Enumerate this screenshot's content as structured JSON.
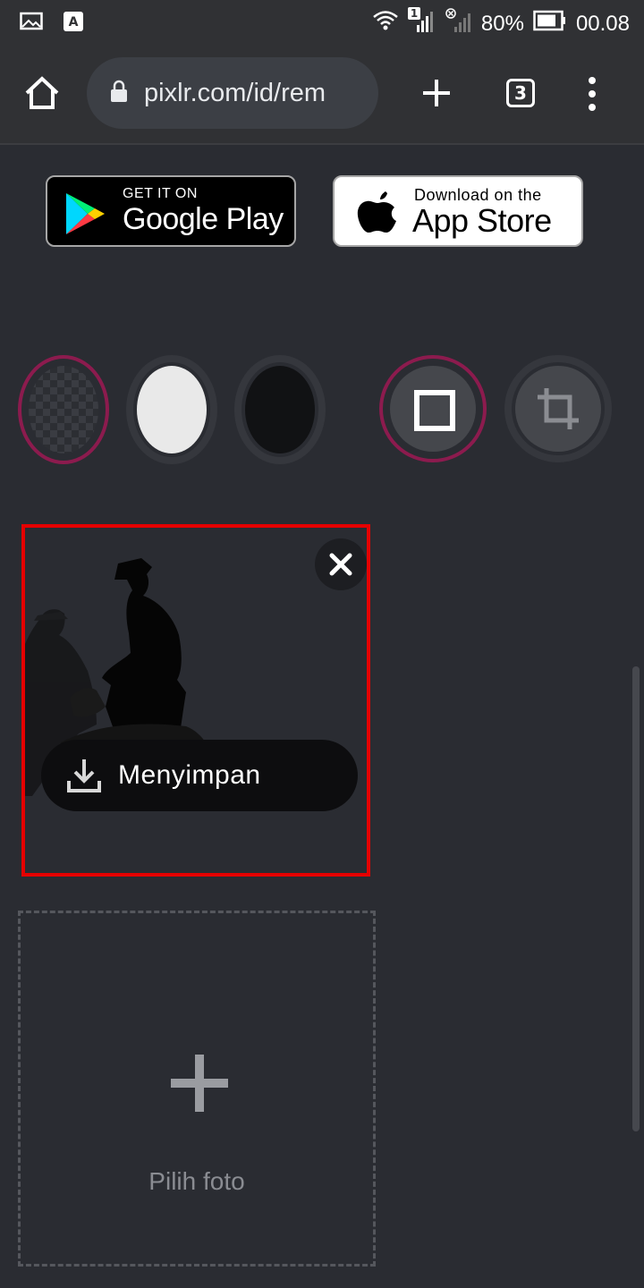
{
  "status_bar": {
    "notification_icons": [
      "gallery-icon",
      "a-letter-icon"
    ],
    "sim_badge": "1",
    "battery": "80%",
    "time": "00.08"
  },
  "browser": {
    "url": "pixlr.com/id/rem",
    "tab_count": "3"
  },
  "store_badges": {
    "google_play": {
      "small": "GET IT ON",
      "big": "Google Play"
    },
    "app_store": {
      "small": "Download on the",
      "big": "App Store"
    }
  },
  "options": {
    "background_choices": [
      "transparent",
      "white",
      "black"
    ],
    "selected_background": "transparent",
    "crop_modes": [
      "square",
      "crop"
    ],
    "selected_crop_mode": "square"
  },
  "image_card": {
    "save_label": "Menyimpan"
  },
  "add_photo": {
    "label": "Pilih foto"
  },
  "colors": {
    "background": "#2a2c32",
    "accent_ring": "#8c1b4e",
    "highlight_border": "#e50000"
  }
}
